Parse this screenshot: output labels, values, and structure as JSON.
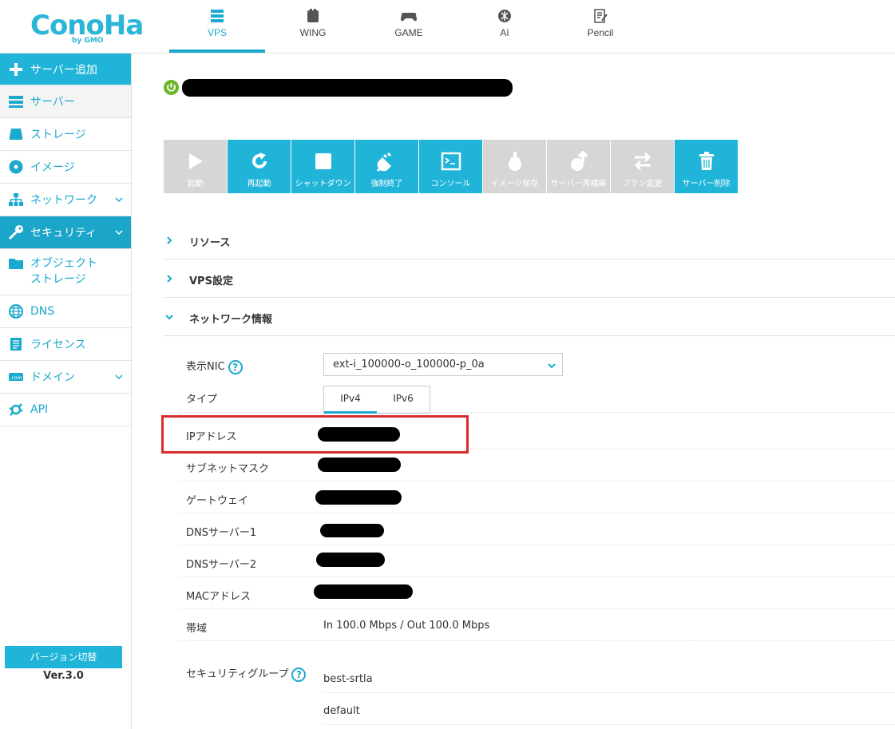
{
  "logo": {
    "text": "ConoHa",
    "sub": "by GMO"
  },
  "nav": [
    {
      "label": "VPS",
      "icon": "server-icon"
    },
    {
      "label": "WING",
      "icon": "wing-icon"
    },
    {
      "label": "GAME",
      "icon": "gamepad-icon"
    },
    {
      "label": "AI",
      "icon": "ai-icon"
    },
    {
      "label": "Pencil",
      "icon": "pencil-icon"
    }
  ],
  "sidebar": {
    "items": [
      {
        "label": "サーバー追加",
        "icon": "plus-icon"
      },
      {
        "label": "サーバー",
        "icon": "server-icon"
      },
      {
        "label": "ストレージ",
        "icon": "storage-icon"
      },
      {
        "label": "イメージ",
        "icon": "disc-icon"
      },
      {
        "label": "ネットワーク",
        "icon": "network-icon"
      },
      {
        "label": "セキュリティ",
        "icon": "key-icon"
      },
      {
        "label": "オブジェクト",
        "label2": "ストレージ",
        "icon": "folder-icon"
      },
      {
        "label": "DNS",
        "icon": "globe-icon"
      },
      {
        "label": "ライセンス",
        "icon": "license-icon"
      },
      {
        "label": "ドメイン",
        "icon": "domain-icon"
      },
      {
        "label": "API",
        "icon": "api-icon"
      }
    ],
    "version_button": "バージョン切替",
    "version": "Ver.3.0"
  },
  "toolbar": [
    {
      "label": "起動",
      "enabled": false,
      "icon": "play-icon"
    },
    {
      "label": "再起動",
      "enabled": true,
      "icon": "restart-icon"
    },
    {
      "label": "シャットダウン",
      "enabled": true,
      "icon": "stop-icon"
    },
    {
      "label": "強制終了",
      "enabled": true,
      "icon": "plug-icon"
    },
    {
      "label": "コンソール",
      "enabled": true,
      "icon": "console-icon"
    },
    {
      "label": "イメージ保存",
      "enabled": false,
      "icon": "image-save-icon"
    },
    {
      "label": "サーバー再構築",
      "enabled": false,
      "icon": "rebuild-icon"
    },
    {
      "label": "プラン変更",
      "enabled": false,
      "icon": "swap-icon"
    },
    {
      "label": "サーバー削除",
      "enabled": true,
      "icon": "trash-icon"
    }
  ],
  "sections": {
    "resource": "リソース",
    "vps_settings": "VPS設定",
    "network_info": "ネットワーク情報"
  },
  "network": {
    "nic_label": "表示NIC",
    "nic_value": "ext-i_100000-o_100000-p_0a",
    "type_label": "タイプ",
    "type_options": [
      "IPv4",
      "IPv6"
    ],
    "type_selected": "IPv4",
    "ip_label": "IPアドレス",
    "subnet_label": "サブネットマスク",
    "gateway_label": "ゲートウェイ",
    "dns1_label": "DNSサーバー1",
    "dns2_label": "DNSサーバー2",
    "mac_label": "MACアドレス",
    "bandwidth_label": "帯域",
    "bandwidth_value": "In 100.0 Mbps / Out 100.0 Mbps",
    "security_group_label": "セキュリティグループ",
    "security_groups": [
      "best-srtla",
      "default"
    ]
  },
  "help_glyph": "?",
  "colors": {
    "accent": "#1fb4d8",
    "disabled": "#d6d6d6",
    "highlight": "#d92b2b",
    "power": "#6bb52a"
  }
}
